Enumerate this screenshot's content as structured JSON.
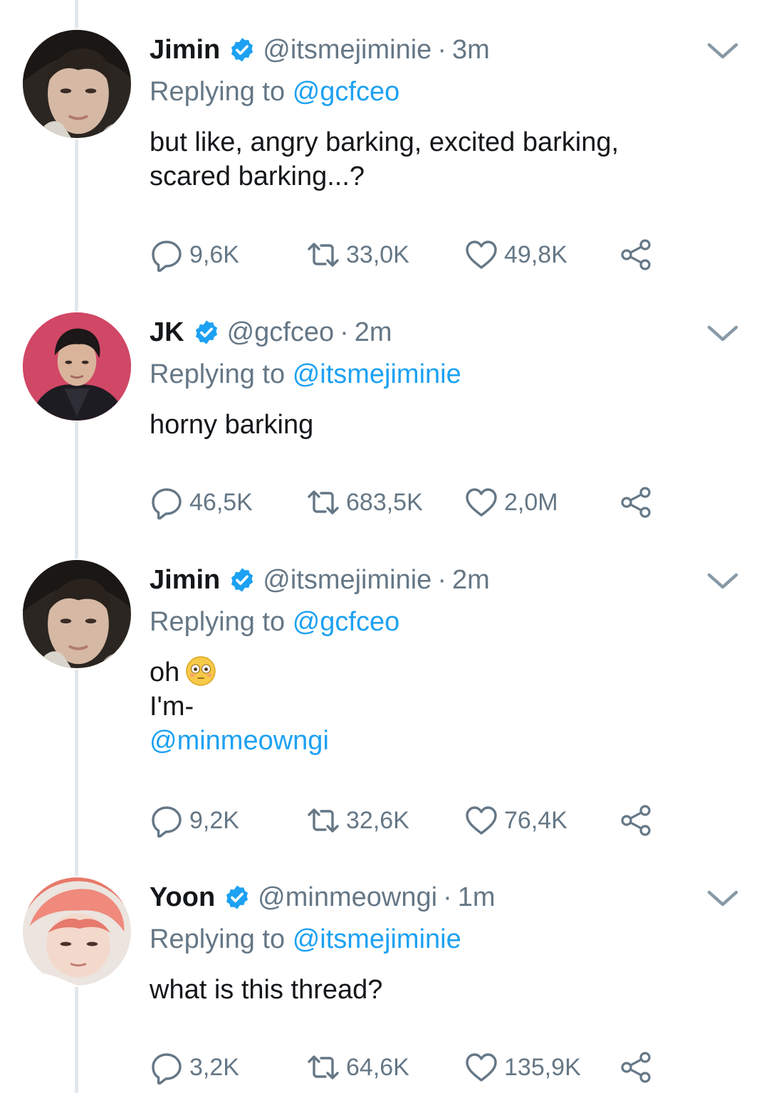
{
  "tweets": [
    {
      "name": "Jimin",
      "handle": "@itsmejiminie",
      "dot": "·",
      "time": "3m",
      "replying_prefix": "Replying to",
      "replying_to": "@gcfceo",
      "lines": [
        "but like, angry barking, excited barking,",
        "scared barking...?"
      ],
      "replies": "9,6K",
      "retweets": "33,0K",
      "likes": "49,8K",
      "avatar_icon": "avatar-jimin"
    },
    {
      "name": "JK",
      "handle": "@gcfceo",
      "dot": "·",
      "time": "2m",
      "replying_prefix": "Replying to",
      "replying_to": "@itsmejiminie",
      "lines": [
        "horny barking"
      ],
      "replies": "46,5K",
      "retweets": "683,5K",
      "likes": "2,0M",
      "avatar_icon": "avatar-jk"
    },
    {
      "name": "Jimin",
      "handle": "@itsmejiminie",
      "dot": "·",
      "time": "2m",
      "replying_prefix": "Replying to",
      "replying_to": "@gcfceo",
      "lines": [
        "oh",
        "I'm-"
      ],
      "link_line": "@minmeowngi",
      "emoji": "flushed-face-emoji",
      "replies": "9,2K",
      "retweets": "32,6K",
      "likes": "76,4K",
      "avatar_icon": "avatar-jimin"
    },
    {
      "name": "Yoon",
      "handle": "@minmeowngi",
      "dot": "·",
      "time": "1m",
      "replying_prefix": "Replying to",
      "replying_to": "@itsmejiminie",
      "lines": [
        "what is this thread?"
      ],
      "replies": "3,2K",
      "retweets": "64,6K",
      "likes": "135,9K",
      "avatar_icon": "avatar-yoon"
    }
  ],
  "colors": {
    "link": "#1da1f2",
    "muted": "#657786",
    "text": "#14171a",
    "thread_line": "#e1e8ed",
    "verified": "#1da1f2"
  }
}
